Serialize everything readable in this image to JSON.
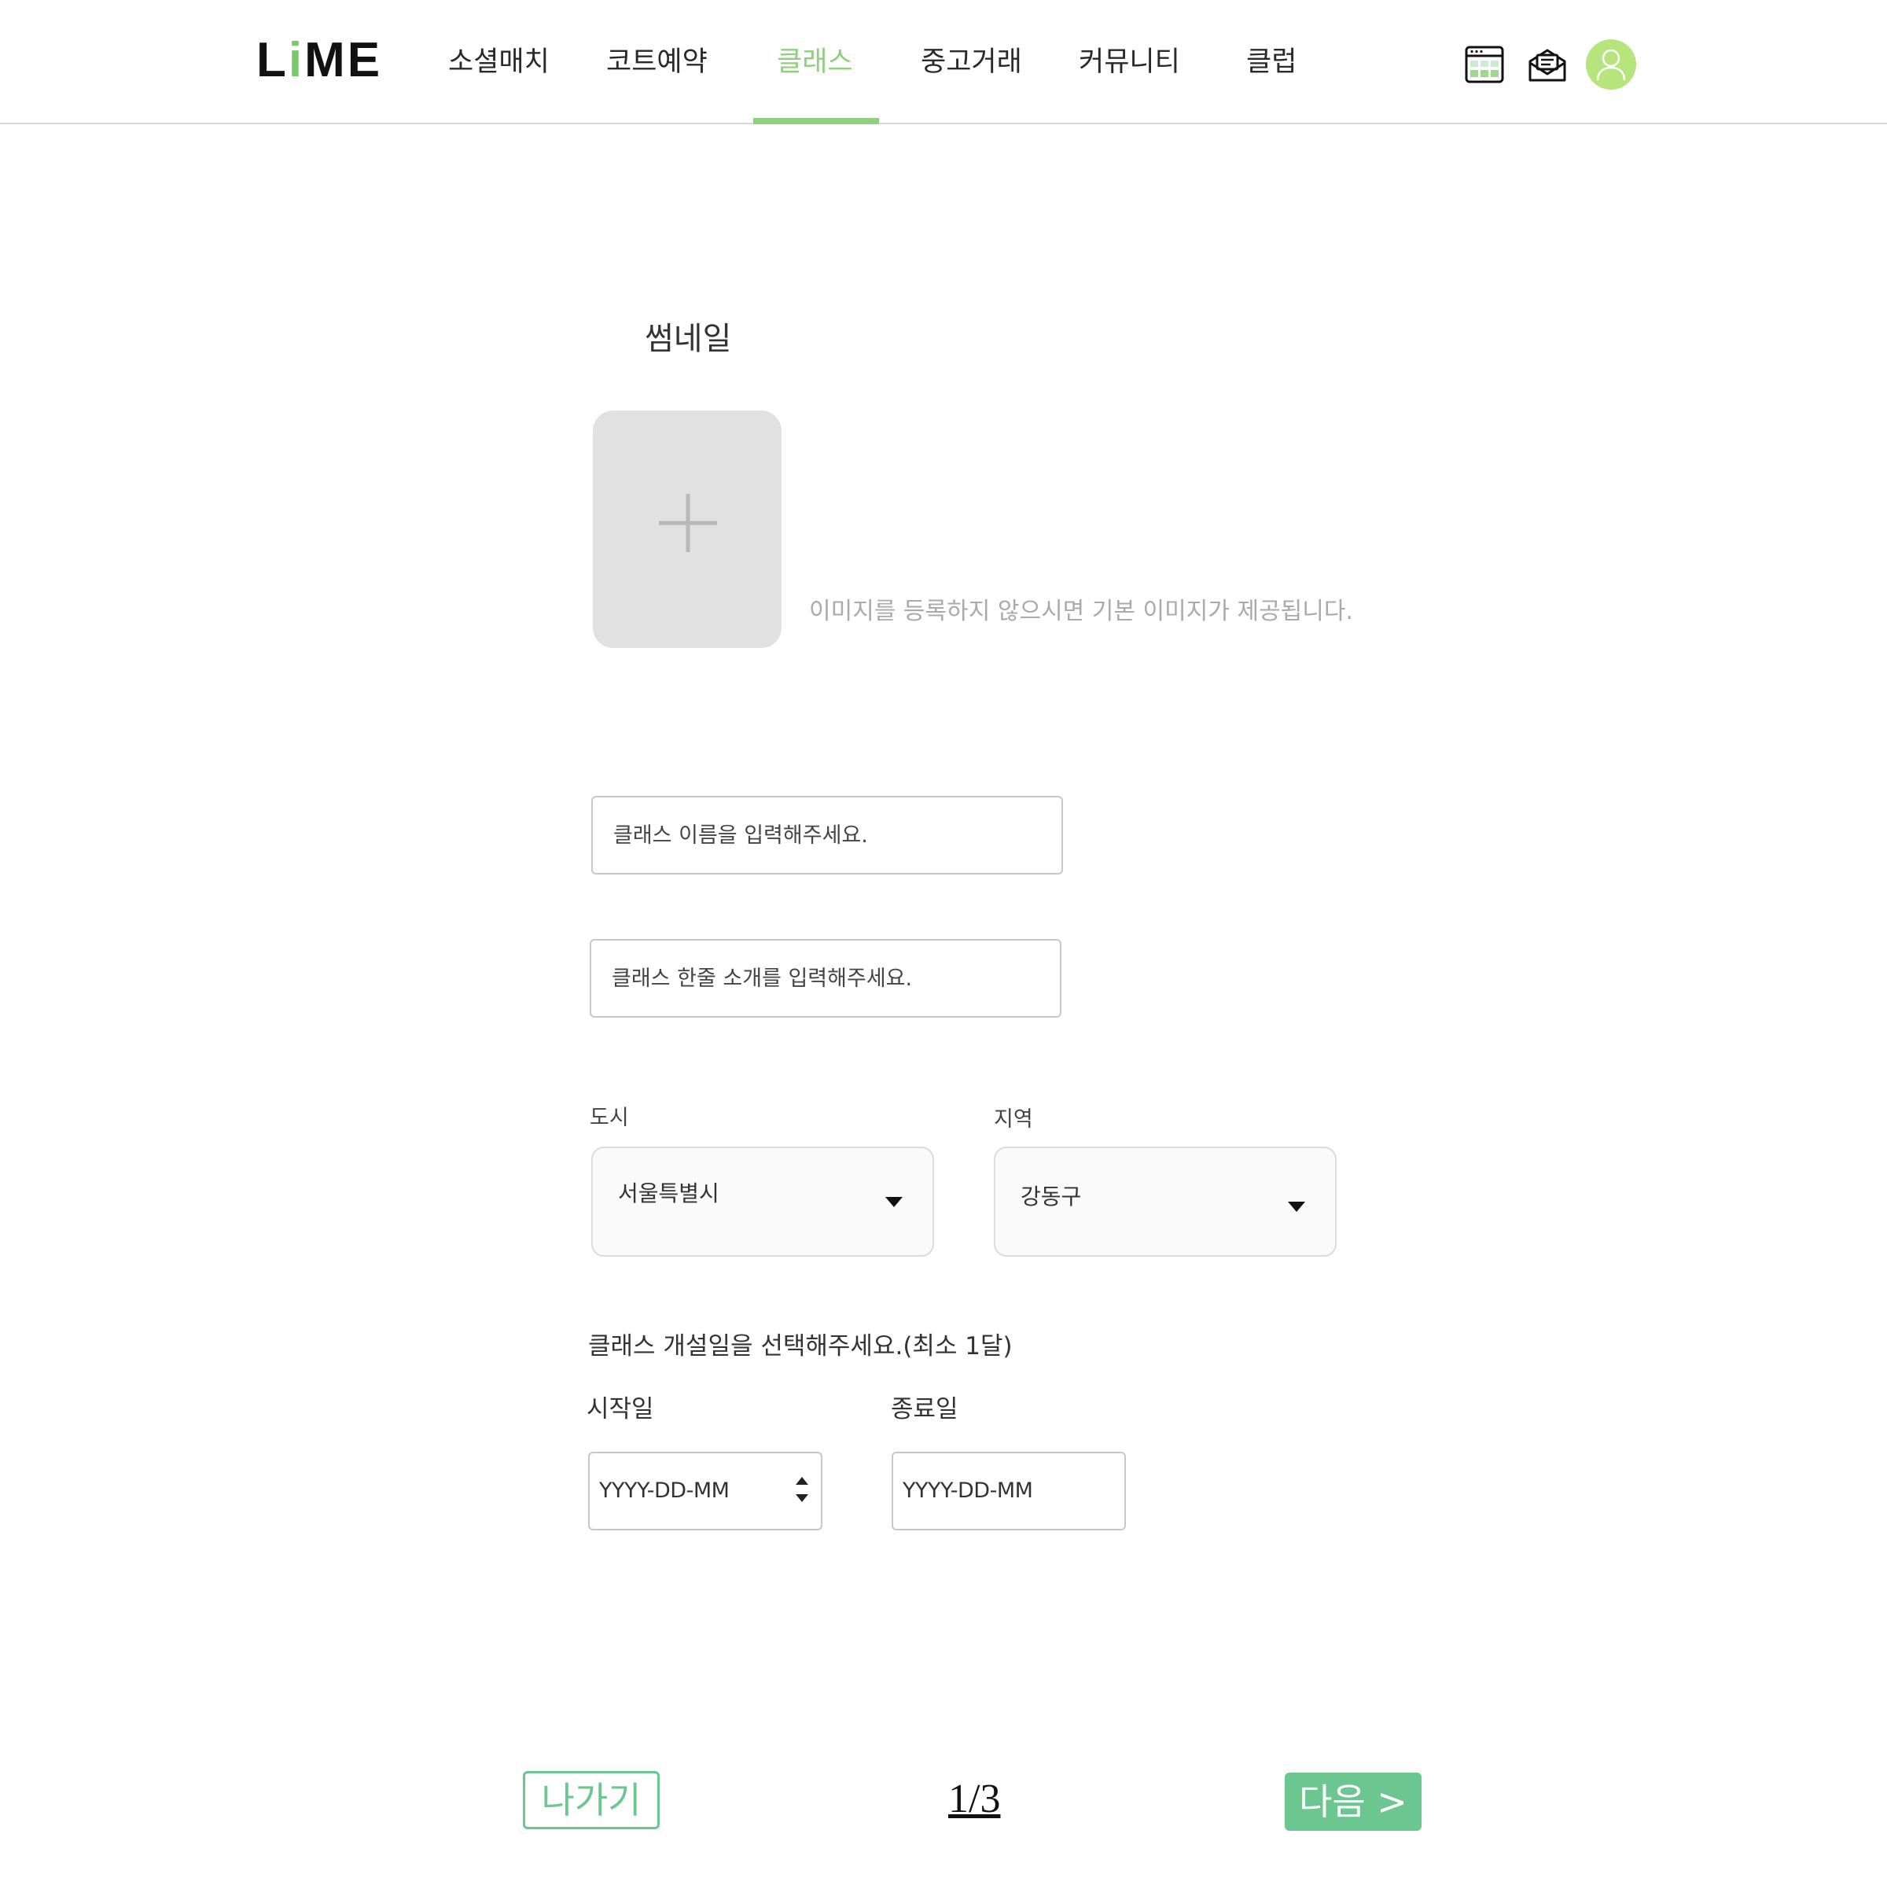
{
  "header": {
    "logo_prefix": "L",
    "logo_accent": "i",
    "logo_suffix": "ME",
    "nav": [
      {
        "label": "소셜매치",
        "active": false
      },
      {
        "label": "코트예약",
        "active": false
      },
      {
        "label": "클래스",
        "active": true
      },
      {
        "label": "중고거래",
        "active": false
      },
      {
        "label": "커뮤니티",
        "active": false
      },
      {
        "label": "클럽",
        "active": false
      }
    ],
    "icons": [
      "calendar-icon",
      "mail-icon",
      "user-avatar-icon"
    ]
  },
  "form": {
    "thumbnail_label": "썸네일",
    "thumbnail_hint": "이미지를 등록하지 않으시면 기본 이미지가 제공됩니다.",
    "class_name_placeholder": "클래스 이름을 입력해주세요.",
    "class_intro_placeholder": "클래스 한줄 소개를 입력해주세요.",
    "city_label": "도시",
    "city_value": "서울특별시",
    "district_label": "지역",
    "district_value": "강동구",
    "period_prompt": "클래스 개설일을 선택해주세요.(최소 1달)",
    "start_label": "시작일",
    "start_value": "YYYY-DD-MM",
    "end_label": "종료일",
    "end_value": "YYYY-DD-MM"
  },
  "footer": {
    "exit_label": "나가기",
    "page_indicator": "1/3",
    "next_label": "다음 >"
  },
  "colors": {
    "accent_green": "#6cc690",
    "nav_active": "#8fd07f",
    "avatar": "#b5e57c"
  }
}
